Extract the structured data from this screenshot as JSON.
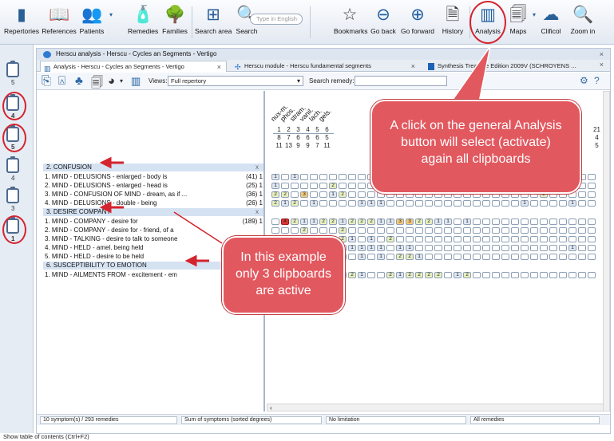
{
  "toolbar": {
    "buttons": [
      {
        "label": "Repertories"
      },
      {
        "label": "References"
      },
      {
        "label": "Patients"
      },
      {
        "label": "Remedies"
      },
      {
        "label": "Families"
      },
      {
        "label": "Search area"
      },
      {
        "label": "Search"
      },
      {
        "label": "Bookmarks"
      },
      {
        "label": "Go back"
      },
      {
        "label": "Go forward"
      },
      {
        "label": "History"
      },
      {
        "label": "Analysis"
      },
      {
        "label": "Maps"
      },
      {
        "label": "Clificol"
      },
      {
        "label": "Zoom in"
      }
    ],
    "search_placeholder": "Type in English"
  },
  "clipboards": [
    "5",
    "4",
    "5",
    "4",
    "3",
    "1"
  ],
  "window": {
    "title": "Herscu analysis - Herscu - Cycles an Segments - Vertigo",
    "tabs": [
      {
        "label": "Analysis - Herscu - Cycles an Segments - Vertigo"
      },
      {
        "label": "Herscu module - Herscu fundamental segments"
      },
      {
        "label": "Synthesis Treasure Edition 2009V (SCHROYENS ..."
      }
    ],
    "close_glyph": "×"
  },
  "subbar": {
    "views_label": "Views:",
    "views_value": "Full repertory",
    "search_remedy_label": "Search remedy:"
  },
  "remedies": [
    "nux-m.",
    "phos.",
    "stram.",
    "vanil.",
    "lach.",
    "gels."
  ],
  "remedies_right": [
    "bov.",
    "glon."
  ],
  "remedy_numbers": {
    "rank": [
      "1",
      "2",
      "3",
      "4",
      "5",
      "6"
    ],
    "symptoms": [
      "8",
      "7",
      "6",
      "6",
      "6",
      "5"
    ],
    "degrees": [
      "11",
      "13",
      "9",
      "9",
      "7",
      "11"
    ],
    "right_rank": "21",
    "right_symptoms": "4",
    "right_degrees": "5"
  },
  "sections": [
    {
      "title": "2. CONFUSION",
      "rows": [
        {
          "label": "1. MIND - DELUSIONS - enlarged - body is",
          "count": "(41) 1"
        },
        {
          "label": "2. MIND - DELUSIONS - enlarged - head is",
          "count": "(25) 1"
        },
        {
          "label": "3. MIND - CONFUSION OF MIND - dream, as if ...",
          "count": "(36) 1"
        },
        {
          "label": "4. MIND - DELUSIONS - double - being",
          "count": "(26) 1"
        }
      ]
    },
    {
      "title": "3. DESIRE COMPANY",
      "rows": [
        {
          "label": "1. MIND - COMPANY - desire for",
          "count": "(189) 1"
        },
        {
          "label": "2. MIND - COMPANY - desire for - friend, of a",
          "count": ""
        },
        {
          "label": "3. MIND - TALKING - desire to talk to someone",
          "count": ""
        },
        {
          "label": "4. MIND - HELD - amel. being held",
          "count": ""
        },
        {
          "label": "5. MIND - HELD - desire to be held",
          "count": ""
        }
      ]
    },
    {
      "title": "6. SUSCEPTIBILITY TO EMOTION",
      "rows": [
        {
          "label": "1. MIND - AILMENTS FROM - excitement - em",
          "count": ""
        }
      ]
    }
  ],
  "status": {
    "symptoms": "10 symptom(s) / 293 remedies",
    "sort": "Sum of symptoms (sorted degrees)",
    "limit": "No limitation",
    "remedies": "All remedies"
  },
  "bottom_hint": "Show table of contents (Ctrl+F2)",
  "callouts": {
    "analysis_text": "A click on the general Analysis button will select (activate) again all clipboards",
    "example_text": "In this example only 3 clipboards are active"
  },
  "colors": {
    "highlight_ring": "#d4242e",
    "callout_fill": "#e2585f",
    "grade1": "#dfe7f3",
    "grade2": "#e9f0c0",
    "grade3": "#f5c977",
    "grade4": "#d93636"
  }
}
